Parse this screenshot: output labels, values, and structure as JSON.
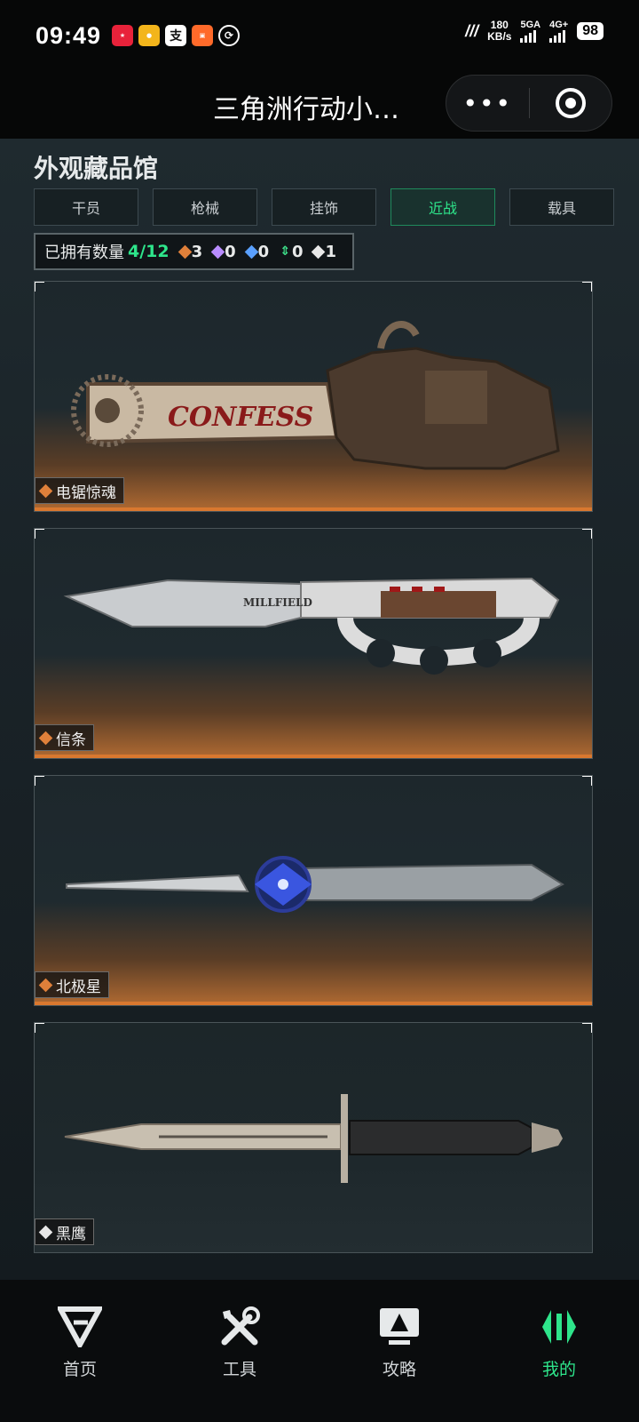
{
  "status_bar": {
    "time": "09:49",
    "speed_value": "180",
    "speed_unit": "KB/s",
    "net1": "5GA",
    "net2": "4G+",
    "battery": "98"
  },
  "title_bar": {
    "title": "三角洲行动小…",
    "more_label": "•••"
  },
  "page": {
    "title": "外观藏品馆",
    "tabs": [
      {
        "label": "干员"
      },
      {
        "label": "枪械"
      },
      {
        "label": "挂饰"
      },
      {
        "label": "近战"
      },
      {
        "label": "载具"
      }
    ],
    "active_tab": "近战",
    "owned": {
      "label": "已拥有数量",
      "count": "4/12",
      "rarities": [
        {
          "color": "#e0803a",
          "value": "3"
        },
        {
          "color": "#b88cff",
          "value": "0"
        },
        {
          "color": "#5aa0ff",
          "value": "0"
        },
        {
          "color": "#3ee08a",
          "value": "0"
        },
        {
          "color": "#e8e8e8",
          "value": "1"
        }
      ]
    }
  },
  "items": [
    {
      "name": "电锯惊魂",
      "rarity_color": "#e0803a"
    },
    {
      "name": "信条",
      "rarity_color": "#e0803a"
    },
    {
      "name": "北极星",
      "rarity_color": "#e0803a"
    },
    {
      "name": "黑鹰",
      "rarity_color": "#e8e8e8"
    }
  ],
  "item_art_text": {
    "chainsaw": "CONFESS",
    "knuckle": "MILLFIELD"
  },
  "bottom_nav": [
    {
      "label": "首页",
      "icon": "home-logo-icon"
    },
    {
      "label": "工具",
      "icon": "tools-icon"
    },
    {
      "label": "攻略",
      "icon": "guide-icon"
    },
    {
      "label": "我的",
      "icon": "profile-logo-icon"
    }
  ],
  "colors": {
    "accent": "#2ee58b",
    "orange": "#d9782f"
  }
}
